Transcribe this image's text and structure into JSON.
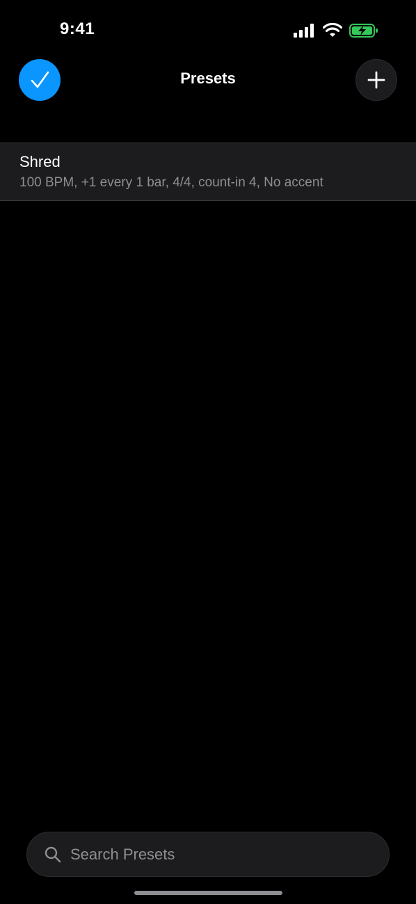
{
  "status_bar": {
    "time": "9:41",
    "icons": [
      "cellular-signal-icon",
      "wifi-icon",
      "battery-charging-icon"
    ],
    "battery_color": "#34c759"
  },
  "nav": {
    "title": "Presets",
    "done_icon": "checkmark-icon",
    "add_icon": "plus-icon",
    "accent_color": "#0a95ff"
  },
  "presets": [
    {
      "name": "Shred",
      "detail": "100 BPM, +1 every 1 bar, 4/4, count-in 4, No accent"
    }
  ],
  "search": {
    "placeholder": "Search Presets",
    "value": ""
  }
}
